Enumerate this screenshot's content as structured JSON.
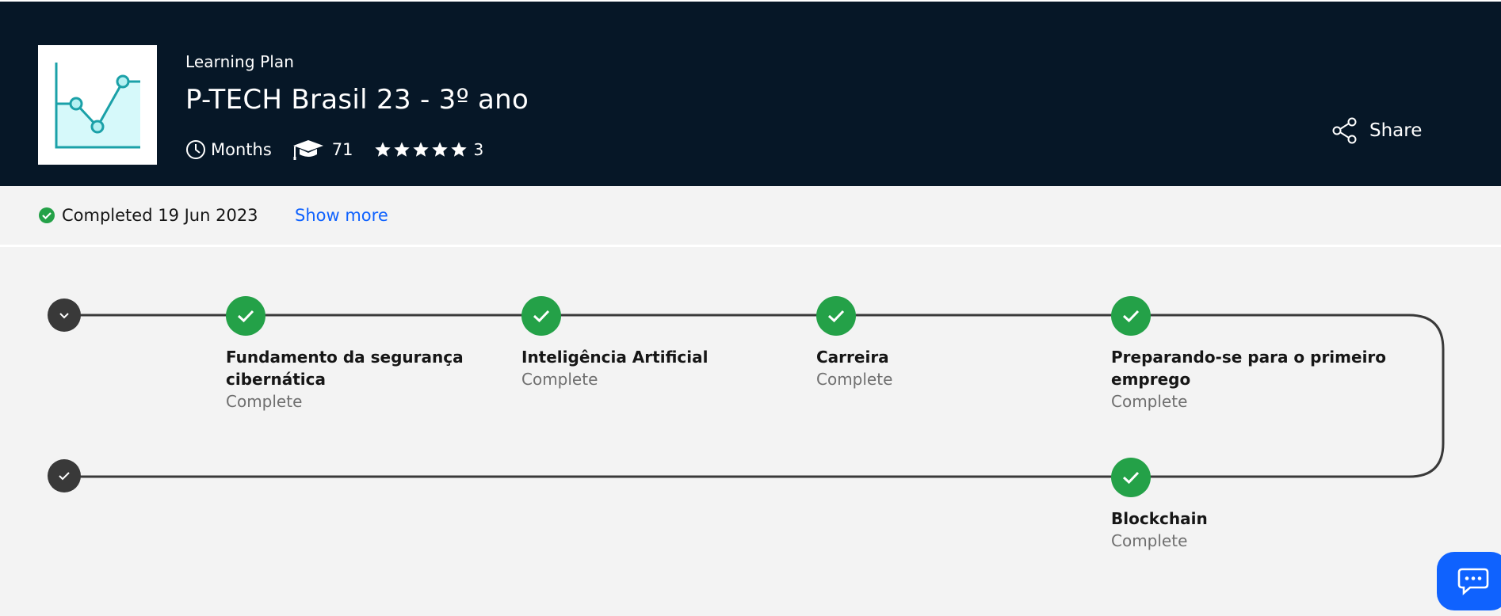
{
  "header": {
    "kicker": "Learning Plan",
    "title": "P-TECH Brasil 23 - 3º ano",
    "duration": "Months",
    "learners": "71",
    "rating_count": "3",
    "stars": 5,
    "share_label": "Share",
    "thumbnail_icon": "line-chart-icon"
  },
  "status": {
    "completed_text": "Completed 19 Jun 2023",
    "show_more": "Show more"
  },
  "path": {
    "courses": [
      {
        "name_lines": [
          "Fundamento da segurança",
          "cibernática"
        ],
        "status": "Complete"
      },
      {
        "name_lines": [
          "Inteligência Artificial"
        ],
        "status": "Complete"
      },
      {
        "name_lines": [
          "Carreira"
        ],
        "status": "Complete"
      },
      {
        "name_lines": [
          "Preparando-se para o primeiro",
          "emprego"
        ],
        "status": "Complete"
      },
      {
        "name_lines": [
          "Blockchain"
        ],
        "status": "Complete"
      }
    ]
  },
  "colors": {
    "header_bg": "#061727",
    "complete_green": "#24a148",
    "link_blue": "#0f62fe",
    "endpoint_dark": "#393939"
  },
  "chat": {
    "icon": "chat-icon"
  }
}
